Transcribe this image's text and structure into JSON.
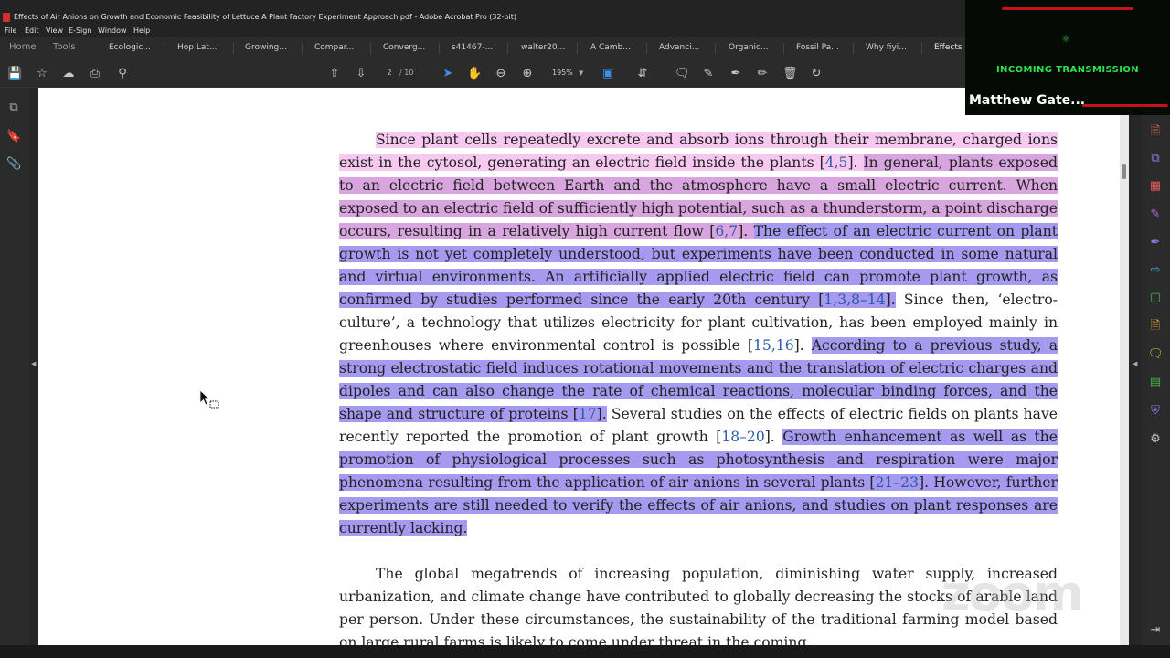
{
  "window": {
    "title": "Effects of Air Anions on Growth and Economic Feasibility of Lettuce A Plant Factory Experiment Approach.pdf - Adobe Acrobat Pro (32-bit)"
  },
  "menu": [
    "File",
    "Edit",
    "View",
    "E-Sign",
    "Window",
    "Help"
  ],
  "tabs": {
    "home": "Home",
    "tools": "Tools",
    "docs": [
      "Ecologic...",
      "Hop Lat...",
      "Growing...",
      "Compar...",
      "Converg...",
      "s41467-...",
      "walter20...",
      "A Camb...",
      "Advanci...",
      "Organic...",
      "Fossil Pa...",
      "Why fiyi...",
      "Effects o..."
    ]
  },
  "toolbar": {
    "page_current": "2",
    "page_total": "/ 10",
    "zoom": "195%"
  },
  "document": {
    "p1": {
      "s1": "Since plant cells repeatedly excrete and absorb ions through their membrane, charged ions exist in the cytosol, generating an electric field inside the plants [",
      "c1": "4,5",
      "s1_end": "]. ",
      "s2": "In general, plants exposed to an electric field between Earth and the atmosphere have a small electric current. When exposed to an electric field of sufficiently high potential, such as a thunderstorm, a point discharge occurs, resulting in a relatively high current flow [",
      "c2": "6,7",
      "s2_end": "]. ",
      "s3": "The effect of an electric current on plant growth is not yet completely understood, but experiments have been conducted in some natural and virtual environments. An artificially applied electric field can promote plant growth, as confirmed by studies performed since the early 20th century [",
      "c3": "1,3,8–14",
      "s3_end": "].",
      "s4": " Since then, ‘electro-culture’, a technology that utilizes electricity for plant cultivation, has been employed mainly in greenhouses where environmental control is possible [",
      "c4": "15,16",
      "s4_end": "]. ",
      "s5": "According to a previous study, a strong electrostatic field induces rotational movements and the translation of electric charges and dipoles and can also change the rate of chemical reactions, molecular binding forces, and the shape and structure of proteins [",
      "c5": "17",
      "s5_end": "].",
      "s6": " Several studies on the effects of electric fields on plants have recently reported the promotion of plant growth [",
      "c6": "18–20",
      "s6_end": "]. ",
      "s7": "Growth enhancement as well as the promotion of physiological processes such as photosynthesis and respiration were major phenomena resulting from the application of air anions in several plants [",
      "c7": "21–23",
      "s7_end": "]. However, further experiments are still needed to verify the effects of air anions, and studies on plant responses are currently lacking."
    },
    "p2": "The global megatrends of increasing population, diminishing water supply, increased urbanization, and climate change have contributed to globally decreasing the stocks of arable land per person. Under these circumstances, the sustainability of the traditional farming model based on large rural farms is likely to come under threat in the coming"
  },
  "video_overlay": {
    "caption": "INCOMING TRANSMISSION",
    "participant_name": "Matthew Gate..."
  },
  "watermark": "zoom",
  "colors": {
    "highlight_pink": "#f7c8f0",
    "highlight_mauve": "#d9a5df",
    "highlight_blue": "#a59af0",
    "citation": "#2b5aa8"
  }
}
